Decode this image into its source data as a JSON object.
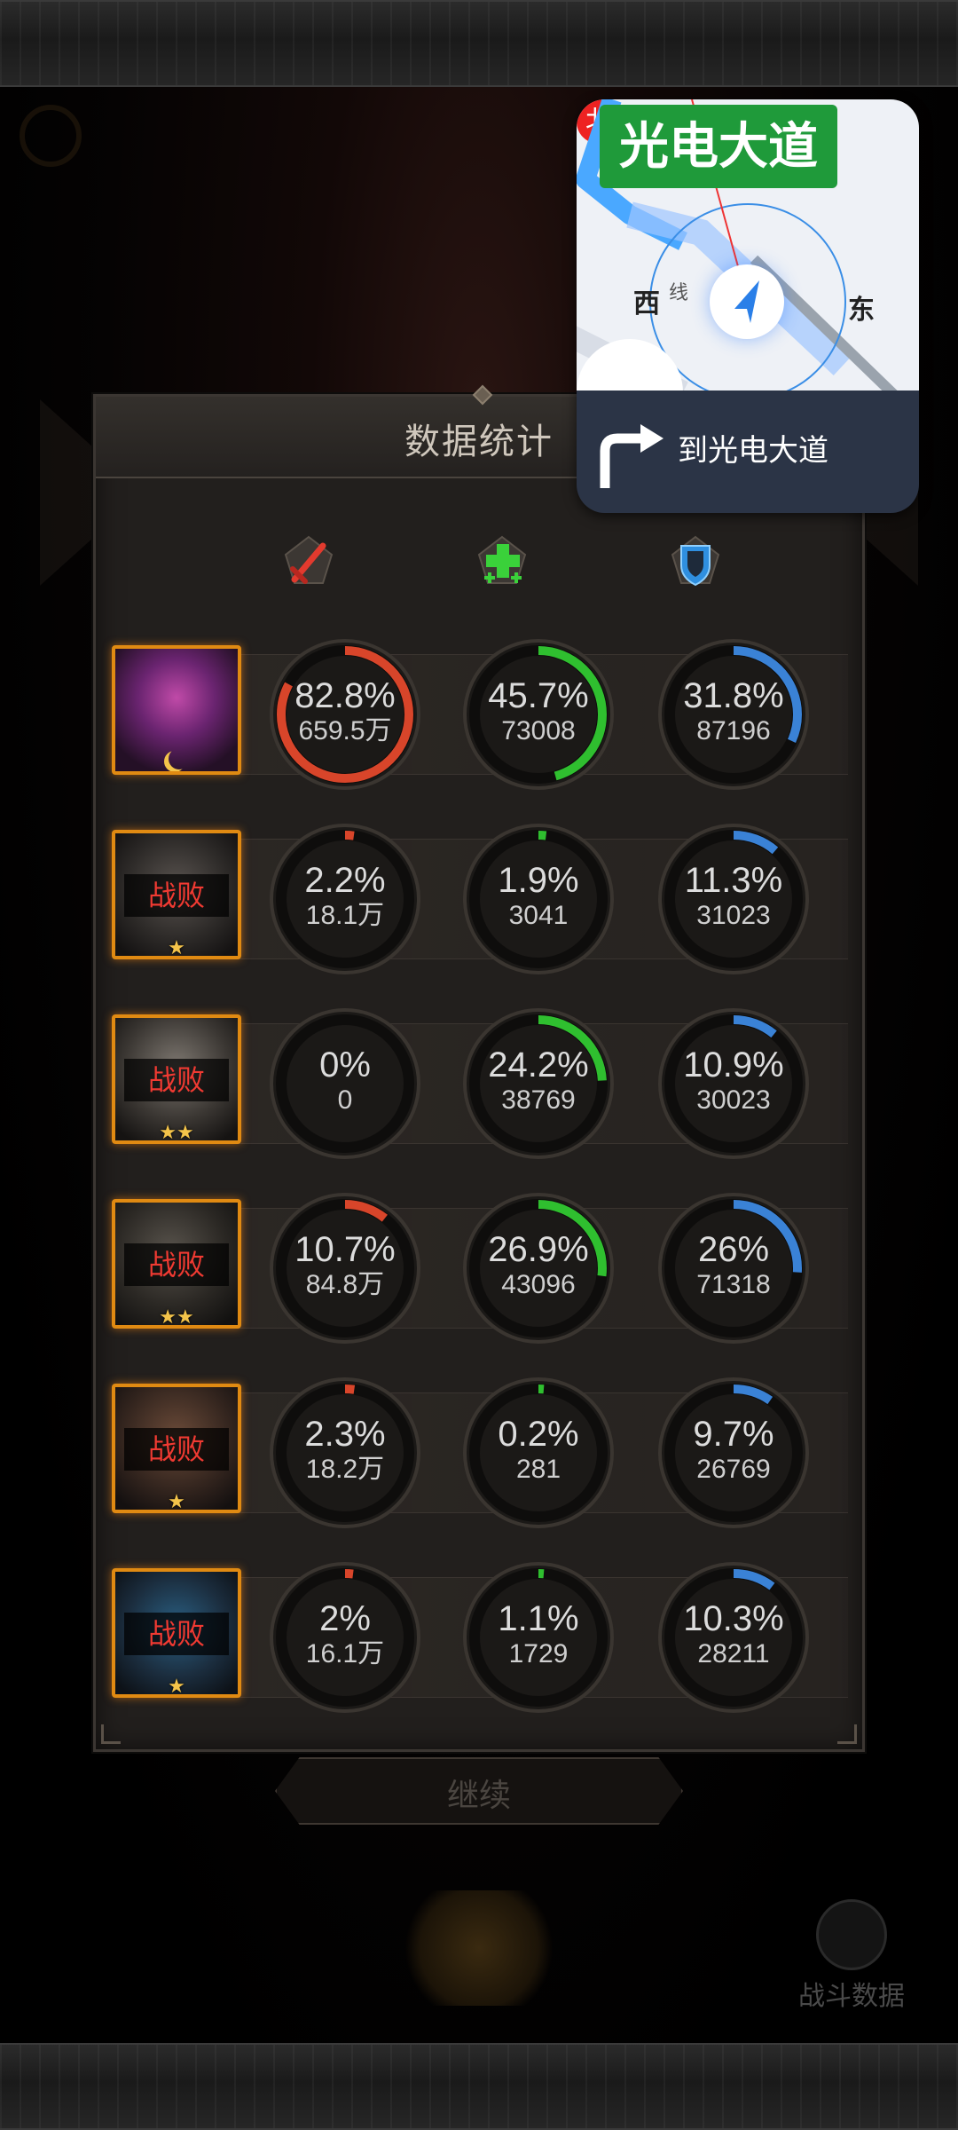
{
  "panel": {
    "title": "数据统计"
  },
  "columns": [
    {
      "name": "damage",
      "icon": "sword-icon"
    },
    {
      "name": "heal",
      "icon": "heal-cross-icon"
    },
    {
      "name": "tank",
      "icon": "shield-icon"
    }
  ],
  "colors": {
    "damage": "#d8452a",
    "heal": "#2fbf2f",
    "tank": "#3a82d6",
    "frame": "#e08a12",
    "defeat": "#f03a32"
  },
  "rows": [
    {
      "status": "",
      "stars": "",
      "damage": {
        "pct": "82.8%",
        "value": "659.5万",
        "fraction": 0.828
      },
      "heal": {
        "pct": "45.7%",
        "value": "73008",
        "fraction": 0.457
      },
      "tank": {
        "pct": "31.8%",
        "value": "87196",
        "fraction": 0.318
      }
    },
    {
      "status": "战败",
      "stars": "★",
      "damage": {
        "pct": "2.2%",
        "value": "18.1万",
        "fraction": 0.022
      },
      "heal": {
        "pct": "1.9%",
        "value": "3041",
        "fraction": 0.019
      },
      "tank": {
        "pct": "11.3%",
        "value": "31023",
        "fraction": 0.113
      }
    },
    {
      "status": "战败",
      "stars": "★★",
      "damage": {
        "pct": "0%",
        "value": "0",
        "fraction": 0
      },
      "heal": {
        "pct": "24.2%",
        "value": "38769",
        "fraction": 0.242
      },
      "tank": {
        "pct": "10.9%",
        "value": "30023",
        "fraction": 0.109
      }
    },
    {
      "status": "战败",
      "stars": "★★",
      "damage": {
        "pct": "10.7%",
        "value": "84.8万",
        "fraction": 0.107
      },
      "heal": {
        "pct": "26.9%",
        "value": "43096",
        "fraction": 0.269
      },
      "tank": {
        "pct": "26%",
        "value": "71318",
        "fraction": 0.26
      }
    },
    {
      "status": "战败",
      "stars": "★",
      "damage": {
        "pct": "2.3%",
        "value": "18.2万",
        "fraction": 0.023
      },
      "heal": {
        "pct": "0.2%",
        "value": "281",
        "fraction": 0.002
      },
      "tank": {
        "pct": "9.7%",
        "value": "26769",
        "fraction": 0.097
      }
    },
    {
      "status": "战败",
      "stars": "★",
      "damage": {
        "pct": "2%",
        "value": "16.1万",
        "fraction": 0.02
      },
      "heal": {
        "pct": "1.1%",
        "value": "1729",
        "fraction": 0.011
      },
      "tank": {
        "pct": "10.3%",
        "value": "28211",
        "fraction": 0.103
      }
    }
  ],
  "buttons": {
    "continue": "继续",
    "battle_data": "战斗数据"
  },
  "navigation": {
    "road_sign": "光电大道",
    "north": "北",
    "west": "西",
    "east": "东",
    "road_label": "线",
    "instruction": "到光电大道"
  }
}
